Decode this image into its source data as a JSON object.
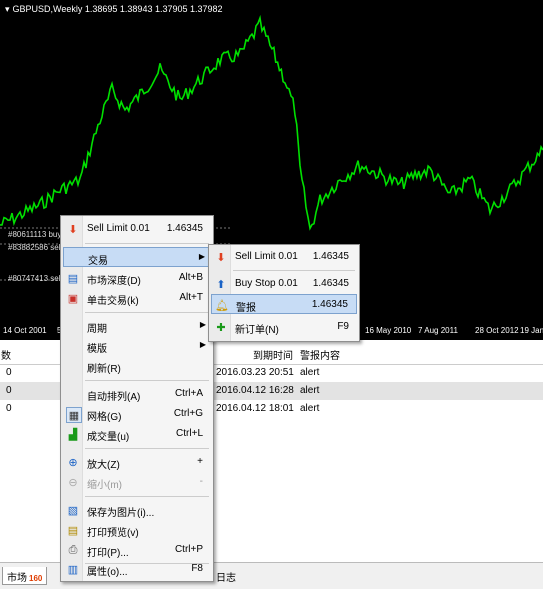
{
  "chart": {
    "symbol_line": "GBPUSD,Weekly  1.38695 1.38943 1.37905 1.37982",
    "order_lines": [
      "#80611113 buy",
      "#83882586 sell",
      "#80747413 sell"
    ],
    "date_labels": [
      "14 Oct 2001",
      "5",
      "16 May 2010",
      "7 Aug 2011",
      "28 Oct 2012",
      "19 Jan"
    ],
    "colors": {
      "background": "#000000",
      "price": "#00e000"
    }
  },
  "terminal": {
    "headers": {
      "count": "数",
      "due_time": "到期时间",
      "alert_content": "警报内容"
    },
    "rows": [
      {
        "count": "0",
        "time": "2016.03.23 20:51",
        "content": "alert"
      },
      {
        "count": "0",
        "time": "2016.04.12 16:28",
        "content": "alert"
      },
      {
        "count": "0",
        "time": "2016.04.12 18:01",
        "content": "alert"
      }
    ],
    "tabs": {
      "market": "市场",
      "market_badge": "160",
      "journal": "日志"
    }
  },
  "context_menu": {
    "top": {
      "label": "Sell Limit 0.01",
      "price": "1.46345"
    },
    "items": {
      "trade": "交易",
      "depth": "市场深度(D)",
      "depth_sc": "Alt+B",
      "oneclick": "单击交易(k)",
      "oneclick_sc": "Alt+T",
      "period": "周期",
      "template": "模版",
      "refresh": "刷新(R)",
      "autoscroll": "自动排列(A)",
      "autoscroll_sc": "Ctrl+A",
      "grid": "网格(G)",
      "grid_sc": "Ctrl+G",
      "volumes": "成交量(u)",
      "volumes_sc": "Ctrl+L",
      "zoomin": "放大(Z)",
      "zoomin_sc": "+",
      "zoomout": "缩小(m)",
      "zoomout_sc": "-",
      "saveimg": "保存为图片(i)...",
      "printpreview": "打印预览(v)",
      "print": "打印(P)...",
      "print_sc": "Ctrl+P",
      "props": "属性(o)...",
      "props_sc": "F8"
    }
  },
  "submenu": {
    "sell_limit": {
      "label": "Sell Limit 0.01",
      "price": "1.46345"
    },
    "buy_stop": {
      "label": "Buy Stop 0.01",
      "price": "1.46345"
    },
    "alert": {
      "label": "警报",
      "price": "1.46345"
    },
    "new_order": {
      "label": "新订单(N)",
      "shortcut": "F9"
    }
  }
}
